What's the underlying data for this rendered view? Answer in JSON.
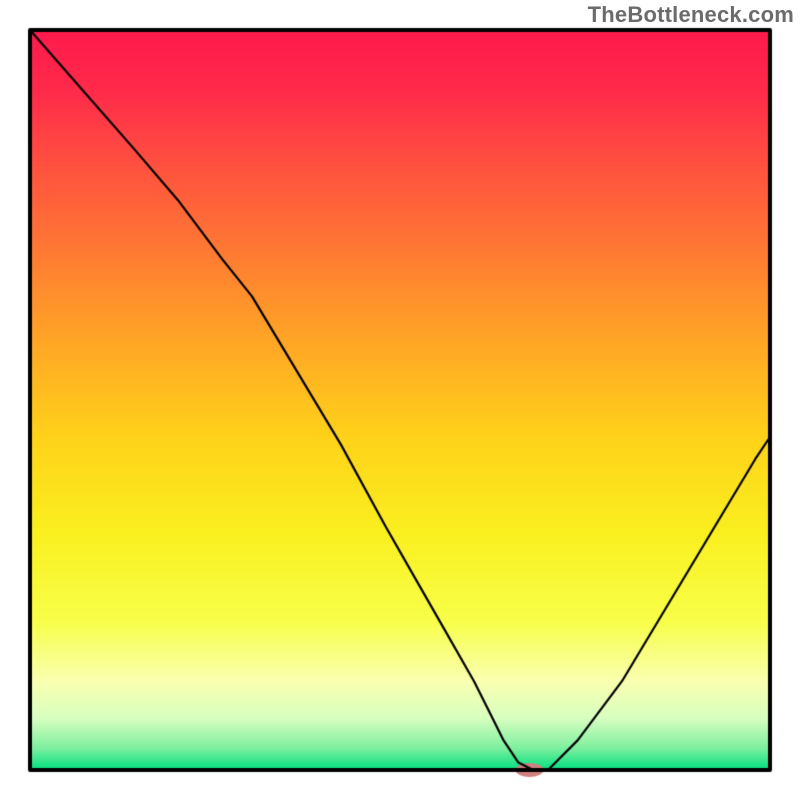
{
  "watermark": "TheBottleneck.com",
  "chart_data": {
    "type": "line",
    "title": "",
    "xlabel": "",
    "ylabel": "",
    "xlim": [
      0,
      100
    ],
    "ylim": [
      0,
      100
    ],
    "background": {
      "gradient_stops": [
        {
          "pos": 0.0,
          "color": "#ff1a4d"
        },
        {
          "pos": 0.08,
          "color": "#ff2a4a"
        },
        {
          "pos": 0.18,
          "color": "#ff5040"
        },
        {
          "pos": 0.3,
          "color": "#ff7a33"
        },
        {
          "pos": 0.42,
          "color": "#ffa626"
        },
        {
          "pos": 0.55,
          "color": "#ffd21a"
        },
        {
          "pos": 0.68,
          "color": "#faf020"
        },
        {
          "pos": 0.8,
          "color": "#f8ff4a"
        },
        {
          "pos": 0.88,
          "color": "#faffb0"
        },
        {
          "pos": 0.93,
          "color": "#d8ffc0"
        },
        {
          "pos": 0.97,
          "color": "#80f0a0"
        },
        {
          "pos": 1.0,
          "color": "#00e080"
        }
      ]
    },
    "series": [
      {
        "name": "bottleneck-curve",
        "color": "#000000",
        "width": 2.2,
        "x": [
          0,
          7,
          14,
          20,
          26,
          30,
          36,
          42,
          48,
          52,
          56,
          60,
          62,
          64,
          66,
          68,
          70,
          74,
          80,
          86,
          92,
          98,
          100
        ],
        "values": [
          100,
          92,
          84,
          77,
          69,
          64,
          54,
          44,
          33,
          26,
          19,
          12,
          8,
          4,
          1,
          0,
          0,
          4,
          12,
          22,
          32,
          42,
          45
        ]
      }
    ],
    "marker": {
      "name": "optimal-point",
      "x": 67.5,
      "y": 0,
      "color": "#d08080",
      "rx": 14,
      "ry": 7
    },
    "frame": {
      "color": "#000000",
      "width": 4
    }
  }
}
